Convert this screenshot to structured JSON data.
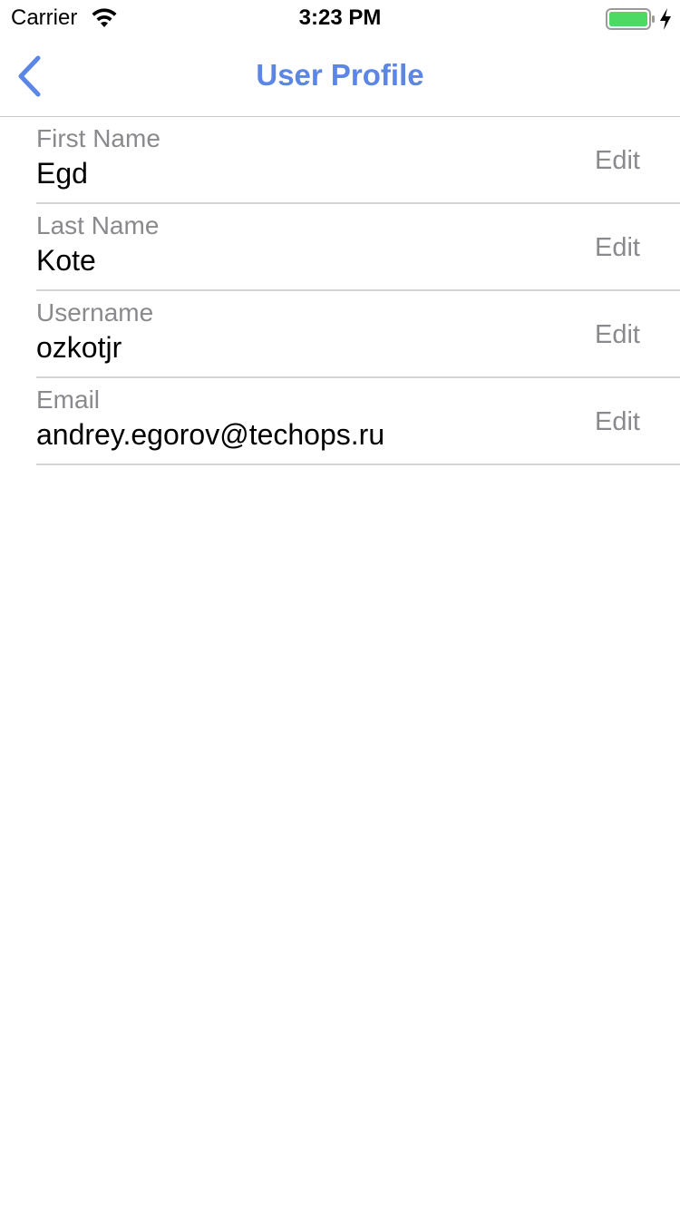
{
  "status_bar": {
    "carrier": "Carrier",
    "time": "3:23 PM",
    "battery_color": "#4cd964"
  },
  "nav": {
    "title": "User Profile",
    "accent_color": "#5b86e5",
    "back_icon": "chevron-left-icon"
  },
  "profile": {
    "rows": [
      {
        "label": "First Name",
        "value": "Egd",
        "action": "Edit"
      },
      {
        "label": "Last Name",
        "value": "Kote",
        "action": "Edit"
      },
      {
        "label": "Username",
        "value": "ozkotjr",
        "action": "Edit"
      },
      {
        "label": "Email",
        "value": "andrey.egorov@techops.ru",
        "action": "Edit"
      }
    ]
  }
}
